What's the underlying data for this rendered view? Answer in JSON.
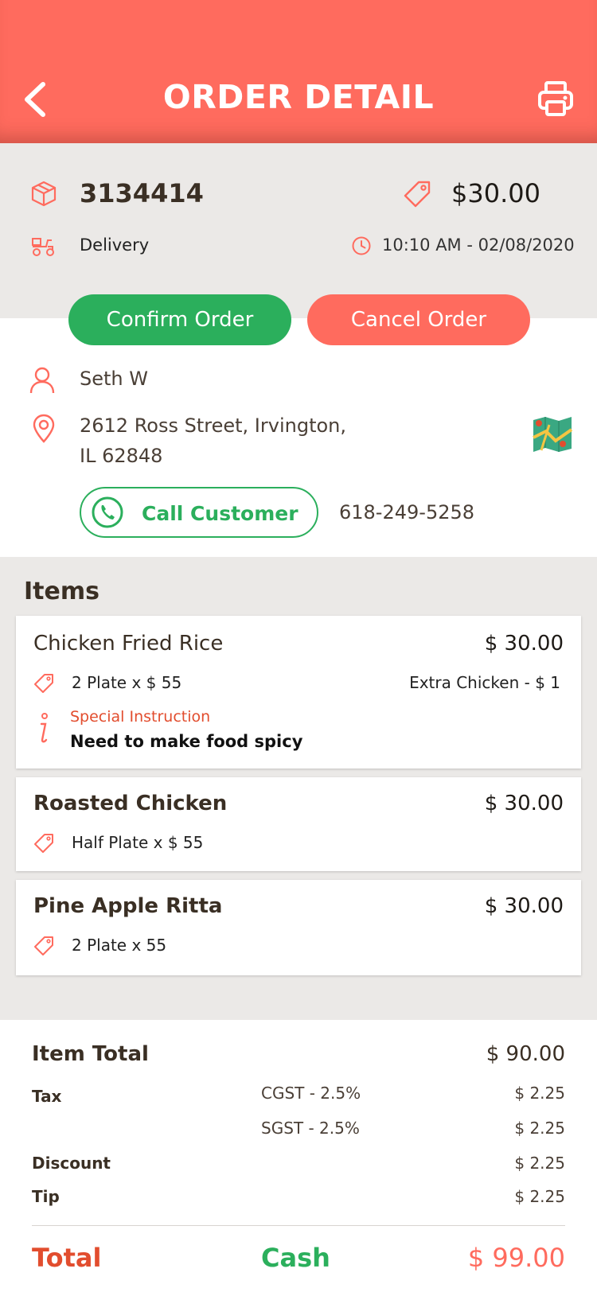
{
  "header": {
    "title": "ORDER DETAIL"
  },
  "order": {
    "id": "3134414",
    "price": "$30.00",
    "type": "Delivery",
    "datetime": "10:10 AM - 02/08/2020"
  },
  "actions": {
    "confirm_label": "Confirm Order",
    "cancel_label": "Cancel Order"
  },
  "customer": {
    "name": "Seth W",
    "address_line1": "2612  Ross Street, Irvington,",
    "address_line2": "IL 62848",
    "call_label": "Call Customer",
    "phone": "618-249-5258"
  },
  "items_section": {
    "title": "Items",
    "items": [
      {
        "name": "Chicken Fried Rice",
        "price": "$ 30.00",
        "qty": "2 Plate x $ 55",
        "extra": "Extra Chicken - $ 1",
        "special_label": "Special Instruction",
        "special_text": "Need to make food spicy"
      },
      {
        "name": "Roasted Chicken",
        "price": "$ 30.00",
        "qty": "Half Plate x $ 55"
      },
      {
        "name": "Pine Apple Ritta",
        "price": "$ 30.00",
        "qty": "2 Plate x 55"
      }
    ]
  },
  "totals": {
    "item_total_label": "Item Total",
    "item_total_value": "$ 90.00",
    "tax_label": "Tax",
    "cgst_label": "CGST  - 2.5%",
    "cgst_value": "$ 2.25",
    "sgst_label": "SGST  - 2.5%",
    "sgst_value": "$ 2.25",
    "discount_label": "Discount",
    "discount_value": "$ 2.25",
    "tip_label": "Tip",
    "tip_value": "$ 2.25",
    "total_label": "Total",
    "payment_method": "Cash",
    "total_value": "$  99.00"
  },
  "colors": {
    "primary": "#ff6b5e",
    "success": "#2baf5c",
    "accent_text": "#e24d2e",
    "background": "#ebe9e7"
  }
}
